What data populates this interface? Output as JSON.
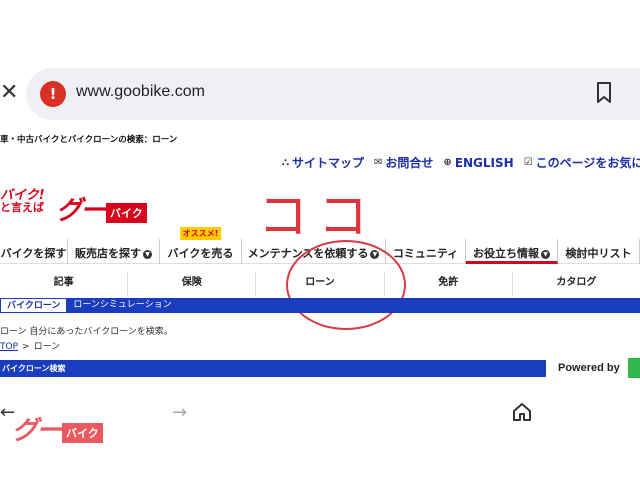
{
  "browser": {
    "url": "www.goobike.com",
    "close_symbol": "✕",
    "url_badge": "!"
  },
  "page": {
    "crumb_top": "車・中古バイクとバイクローンの検索：ローン",
    "top_links": [
      {
        "icon": "⛬",
        "label": "サイトマップ"
      },
      {
        "icon": "✉",
        "label": "お問合せ"
      },
      {
        "icon": "⊕",
        "label": "ENGLISH"
      },
      {
        "icon": "☑",
        "label": "このページをお気に"
      }
    ],
    "logo": {
      "tag_line1": "バイク!",
      "tag_line2": "と言えば",
      "goo": "グー",
      "bike": "バイク"
    },
    "annotation_text": "ココ",
    "nav": [
      {
        "label": "バイクを探す",
        "chevron": false,
        "badge": ""
      },
      {
        "label": "販売店を探す",
        "chevron": true,
        "badge": ""
      },
      {
        "label": "バイクを売る",
        "chevron": false,
        "badge": "オススメ!"
      },
      {
        "label": "メンテナンスを依頼する",
        "chevron": true,
        "badge": ""
      },
      {
        "label": "コミュニティ",
        "chevron": false,
        "badge": ""
      },
      {
        "label": "お役立ち情報",
        "chevron": true,
        "badge": "",
        "active": true
      },
      {
        "label": "検討中リスト",
        "chevron": false,
        "badge": ""
      }
    ],
    "subnav": [
      "記事",
      "保険",
      "ローン",
      "免許",
      "カタログ"
    ],
    "tabs": [
      {
        "label": "バイクローン",
        "active": true
      },
      {
        "label": "ローンシミュレーション",
        "active": false
      }
    ],
    "description": "ローン 自分にあったバイクローンを検索。",
    "breadcrumb": {
      "top": "TOP",
      "sep": ">",
      "current": "ローン"
    },
    "section_title": "バイクローン検索",
    "powered_by": "Powered by"
  },
  "bottom_bar": {
    "back": "←",
    "forward": "→"
  },
  "watermark": {
    "goo": "グー",
    "bike": "バイク"
  }
}
